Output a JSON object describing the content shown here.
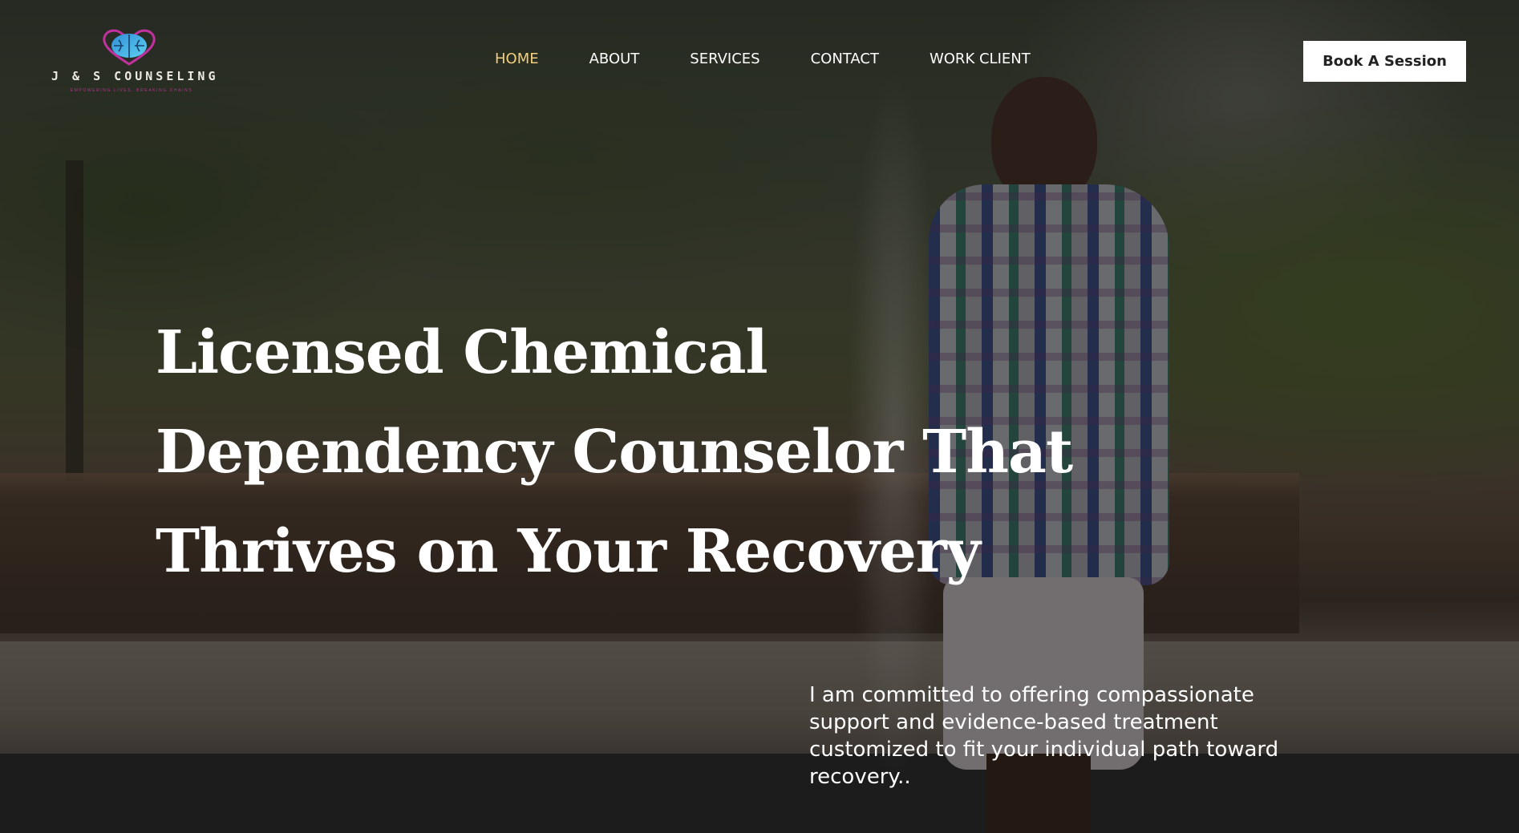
{
  "brand": {
    "name": "J & S COUNSELING",
    "tagline": "EMPOWERING LIVES, BREAKING CHAINS",
    "logo_icon": "brain-heart-icon",
    "colors": {
      "logo_blue": "#3fb6e6",
      "logo_magenta": "#c0319e"
    }
  },
  "nav": {
    "items": [
      {
        "label": "HOME",
        "active": true
      },
      {
        "label": "ABOUT",
        "active": false
      },
      {
        "label": "SERVICES",
        "active": false
      },
      {
        "label": "CONTACT",
        "active": false
      },
      {
        "label": "WORK CLIENT",
        "active": false
      }
    ],
    "active_color": "#f0ce7c"
  },
  "cta": {
    "label": "Book A Session"
  },
  "hero": {
    "headline": "Licensed Chemical Dependency Counselor That Thrives on Your Recovery",
    "subtext": "I am committed to offering compassionate support and evidence-based treatment customized to fit your individual path toward recovery.."
  }
}
